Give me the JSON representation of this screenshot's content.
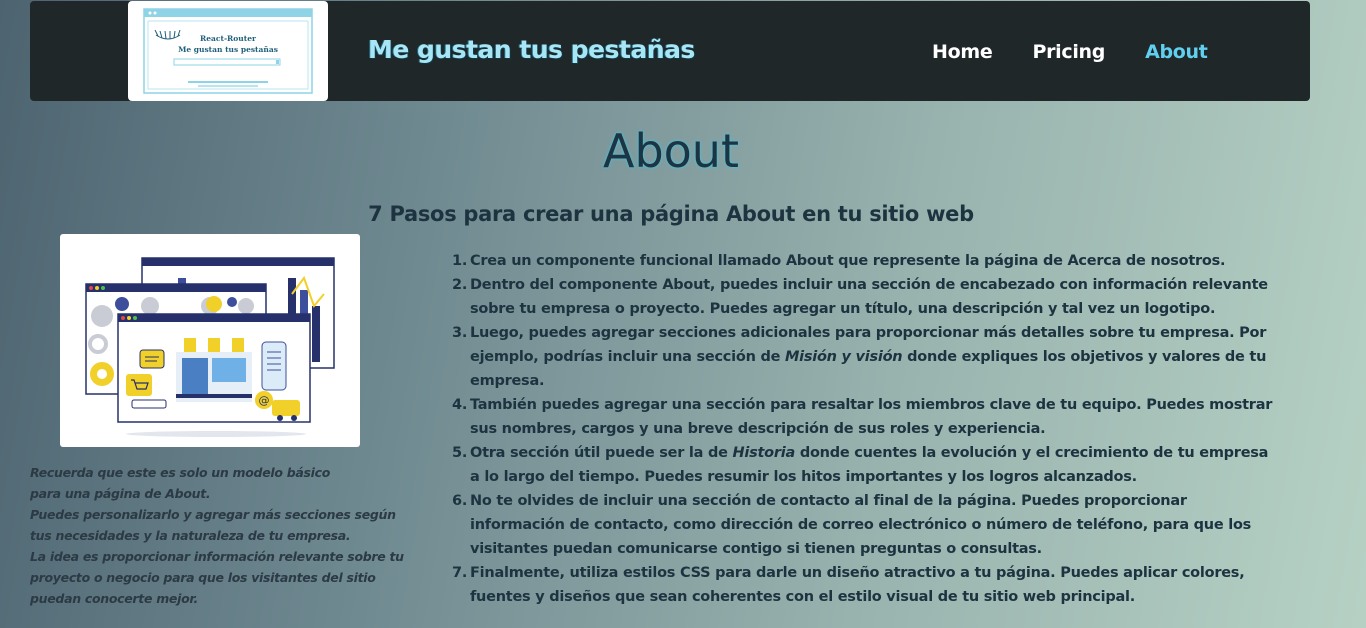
{
  "navbar": {
    "logo_text_line1": "React-Router",
    "logo_text_line2": "Me gustan tus pestañas",
    "site_title": "Me gustan tus pestañas",
    "links": [
      {
        "label": "Home",
        "active": false
      },
      {
        "label": "Pricing",
        "active": false
      },
      {
        "label": "About",
        "active": true
      }
    ]
  },
  "page": {
    "heading": "About",
    "subheading": "7 Pasos para crear una página About en tu sitio web"
  },
  "note_lines": [
    "Recuerda que este es solo un modelo básico",
    "para una página de About.",
    "Puedes personalizarlo y agregar más secciones según",
    "tus necesidades y la naturaleza de tu empresa.",
    "La idea es proporcionar información relevante sobre tu",
    "proyecto o negocio para que los visitantes del sitio",
    "puedan conocerte mejor."
  ],
  "steps": [
    {
      "num": "1.",
      "pre": "Crea un componente funcional llamado About que represente la página de Acerca de nosotros.",
      "em": "",
      "post": ""
    },
    {
      "num": "2.",
      "pre": "Dentro del componente About, puedes incluir una sección de encabezado con información relevante sobre tu empresa o proyecto. Puedes agregar un título, una descripción y tal vez un logotipo.",
      "em": "",
      "post": ""
    },
    {
      "num": "3.",
      "pre": "Luego, puedes agregar secciones adicionales para proporcionar más detalles sobre tu empresa. Por ejemplo, podrías incluir una sección de ",
      "em": "Misión y visión",
      "post": " donde expliques los objetivos y valores de tu empresa."
    },
    {
      "num": "4.",
      "pre": "También puedes agregar una sección para resaltar los miembros clave de tu equipo. Puedes mostrar sus nombres, cargos y una breve descripción de sus roles y experiencia.",
      "em": "",
      "post": ""
    },
    {
      "num": "5.",
      "pre": "Otra sección útil puede ser la de ",
      "em": "Historia",
      "post": " donde cuentes la evolución y el crecimiento de tu empresa a lo largo del tiempo. Puedes resumir los hitos importantes y los logros alcanzados."
    },
    {
      "num": "6.",
      "pre": "No te olvides de incluir una sección de contacto al final de la página. Puedes proporcionar información de contacto, como dirección de correo electrónico o número de teléfono, para que los visitantes puedan comunicarse contigo si tienen preguntas o consultas.",
      "em": "",
      "post": ""
    },
    {
      "num": "7.",
      "pre": "Finalmente, utiliza estilos CSS para darle un diseño atractivo a tu página. Puedes aplicar colores, fuentes y diseños que sean coherentes con el estilo visual de tu sitio web principal.",
      "em": "",
      "post": ""
    }
  ]
}
